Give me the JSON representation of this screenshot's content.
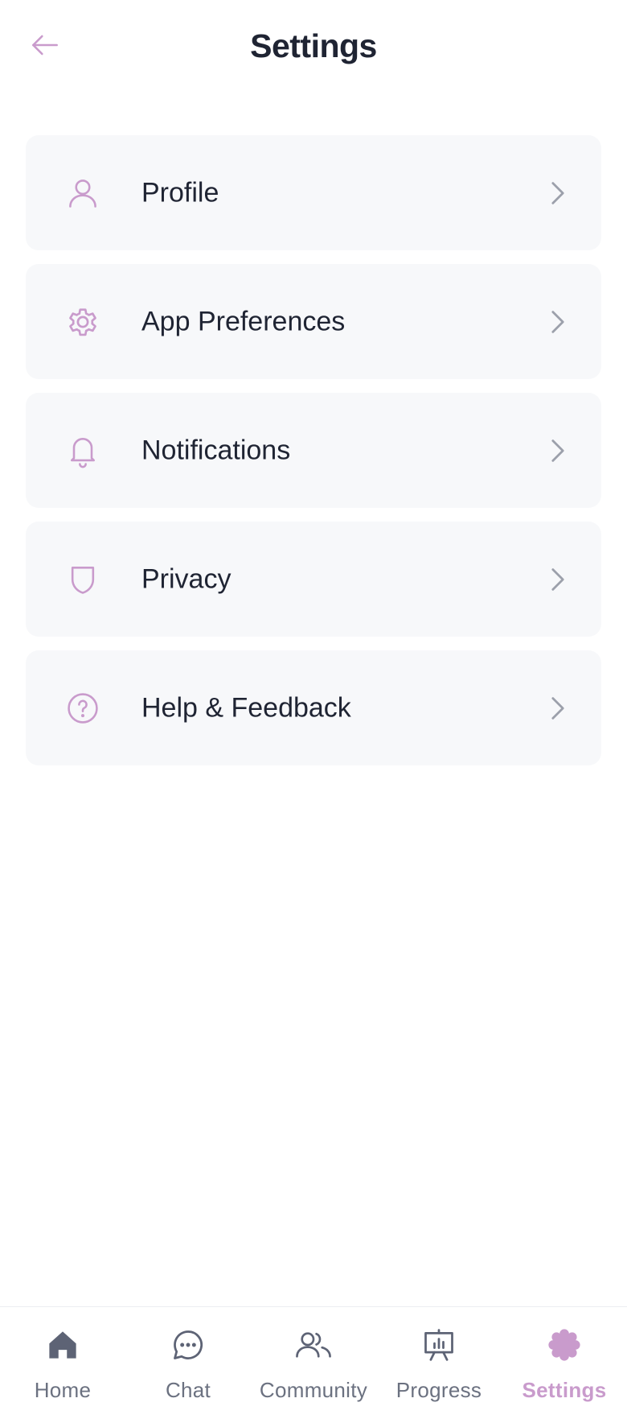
{
  "header": {
    "title": "Settings",
    "back_icon": "arrow-left-icon"
  },
  "colors": {
    "accent": "#c99bcc",
    "text": "#1f2433",
    "card": "#f7f8fa",
    "nav_inactive": "#6b7180",
    "chevron": "#9ca0ab"
  },
  "settings": {
    "items": [
      {
        "label": "Profile",
        "icon": "user-icon"
      },
      {
        "label": "App Preferences",
        "icon": "gear-icon"
      },
      {
        "label": "Notifications",
        "icon": "bell-icon"
      },
      {
        "label": "Privacy",
        "icon": "shield-icon"
      },
      {
        "label": "Help & Feedback",
        "icon": "help-circle-icon"
      }
    ]
  },
  "nav": {
    "items": [
      {
        "label": "Home",
        "icon": "home-icon",
        "active": false
      },
      {
        "label": "Chat",
        "icon": "chat-icon",
        "active": false
      },
      {
        "label": "Community",
        "icon": "community-icon",
        "active": false
      },
      {
        "label": "Progress",
        "icon": "progress-icon",
        "active": false
      },
      {
        "label": "Settings",
        "icon": "settings-flower-icon",
        "active": true
      }
    ]
  }
}
